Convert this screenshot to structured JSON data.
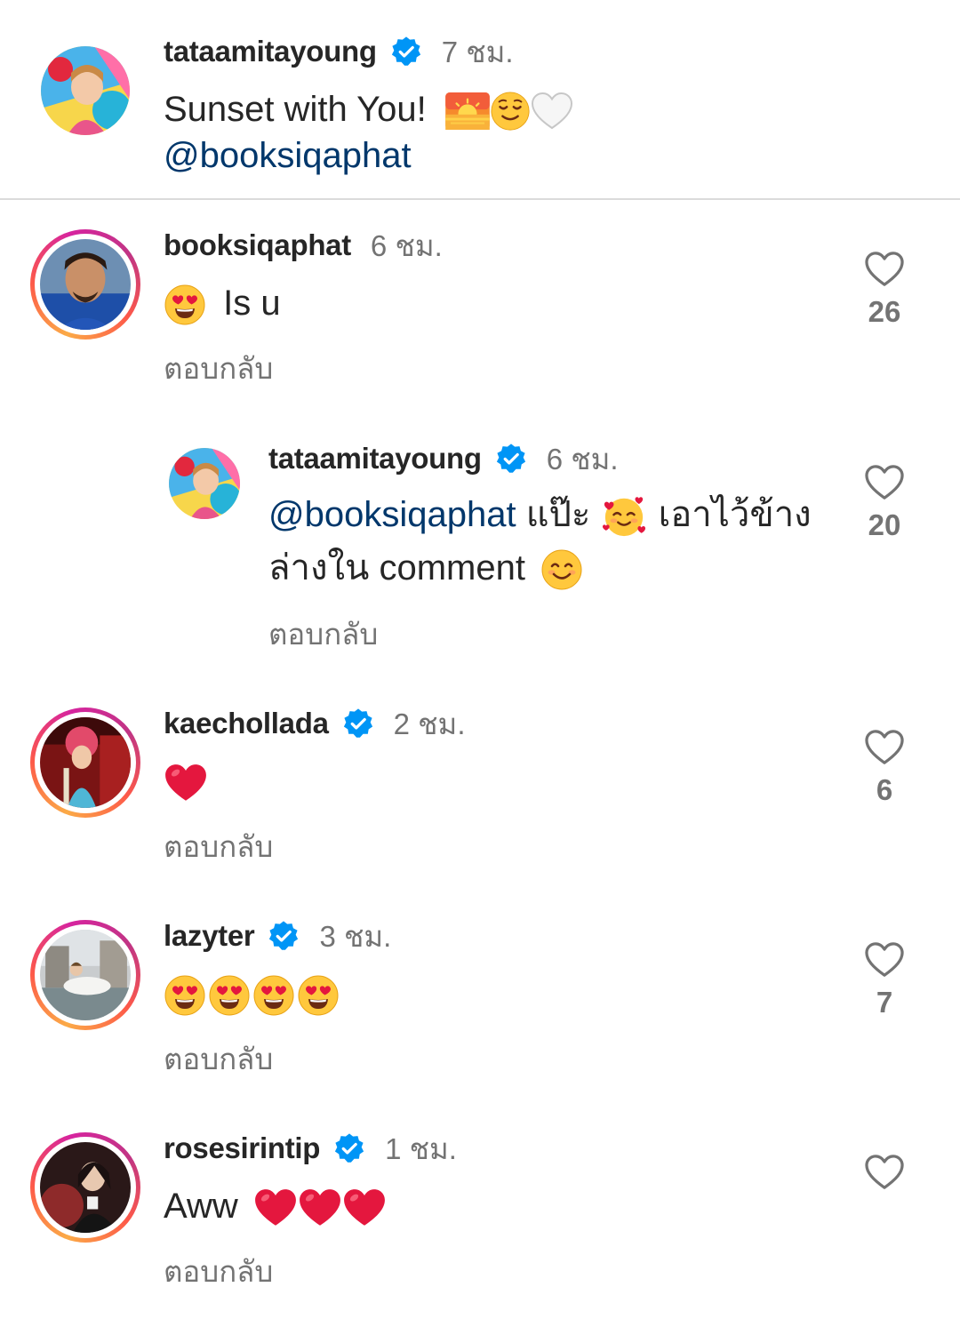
{
  "caption": {
    "username": "tataamitayoung",
    "time": "7 ชม.",
    "text": "Sunset with You!",
    "mention": "@booksiqaphat"
  },
  "comments": [
    {
      "username": "booksiqaphat",
      "time": "6 ชม.",
      "verified": false,
      "text": "Is u",
      "reply_label": "ตอบกลับ",
      "likes": "26"
    },
    {
      "username": "tataamitayoung",
      "time": "6 ชม.",
      "verified": true,
      "mention": "@booksiqaphat",
      "text_line1_a": "แป๊ะ",
      "text_line1_b": "เอาไว้ข้าง",
      "text_line2": "ล่างใน comment",
      "reply_label": "ตอบกลับ",
      "likes": "20"
    },
    {
      "username": "kaechollada",
      "time": "2 ชม.",
      "verified": true,
      "reply_label": "ตอบกลับ",
      "likes": "6"
    },
    {
      "username": "lazyter",
      "time": "3 ชม.",
      "verified": true,
      "reply_label": "ตอบกลับ",
      "likes": "7"
    },
    {
      "username": "rosesirintip",
      "time": "1 ชม.",
      "verified": true,
      "text": "Aww",
      "reply_label": "ตอบกลับ",
      "likes": ""
    }
  ],
  "colors": {
    "verified_blue": "#0095f6",
    "mention_blue": "#00376b",
    "heart_red": "#e4173e",
    "secondary_text": "#737373"
  },
  "icons": [
    "verified-badge-icon",
    "heart-outline-icon",
    "sunrise-emoji",
    "smiling-face-emoji",
    "white-heart-emoji",
    "heart-eyes-emoji",
    "smiling-hearts-emoji",
    "blush-emoji",
    "red-heart-emoji"
  ]
}
